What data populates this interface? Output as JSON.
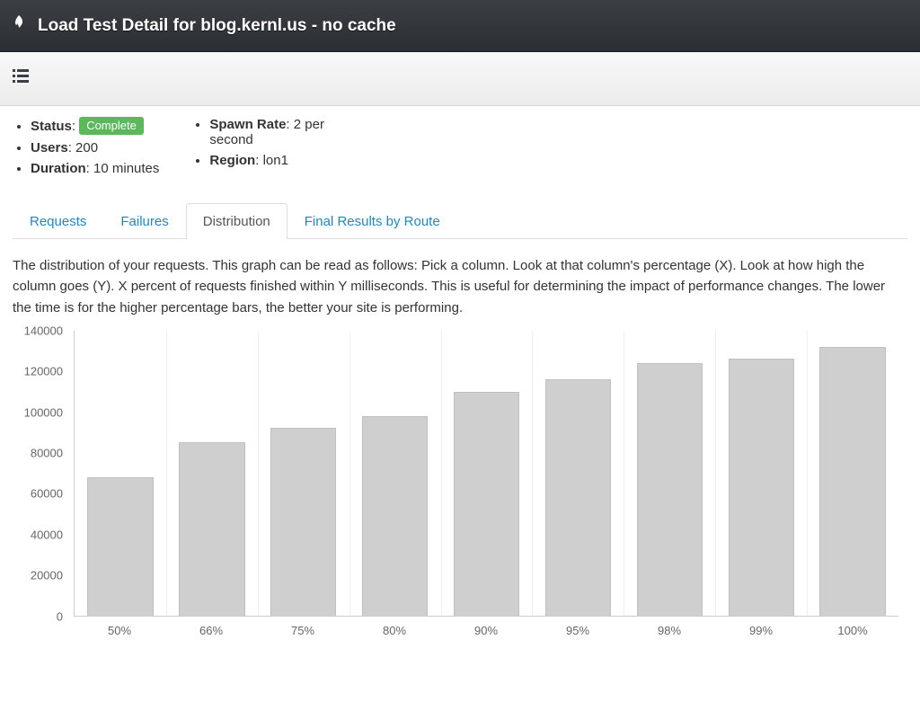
{
  "header": {
    "title": "Load Test Detail for blog.kernl.us - no cache",
    "icon": "flame-icon"
  },
  "meta": {
    "status_label": "Status",
    "status_value": "Complete",
    "users_label": "Users",
    "users_value": "200",
    "duration_label": "Duration",
    "duration_value": "10 minutes",
    "spawn_rate_label": "Spawn Rate",
    "spawn_rate_value": "2 per second",
    "region_label": "Region",
    "region_value": "lon1"
  },
  "tabs": {
    "items": [
      {
        "label": "Requests",
        "active": false
      },
      {
        "label": "Failures",
        "active": false
      },
      {
        "label": "Distribution",
        "active": true
      },
      {
        "label": "Final Results by Route",
        "active": false
      }
    ]
  },
  "description": "The distribution of your requests. This graph can be read as follows: Pick a column. Look at that column's percentage (X). Look at how high the column goes (Y). X percent of requests finished within Y milliseconds. This is useful for determining the impact of performance changes. The lower the time is for the higher percentage bars, the better your site is performing.",
  "chart_data": {
    "type": "bar",
    "title": "",
    "xlabel": "",
    "ylabel": "",
    "ylim": [
      0,
      140000
    ],
    "y_ticks": [
      0,
      20000,
      40000,
      60000,
      80000,
      100000,
      120000,
      140000
    ],
    "categories": [
      "50%",
      "66%",
      "75%",
      "80%",
      "90%",
      "95%",
      "98%",
      "99%",
      "100%"
    ],
    "values": [
      68000,
      85000,
      92000,
      98000,
      110000,
      116000,
      124000,
      126000,
      132000
    ]
  }
}
